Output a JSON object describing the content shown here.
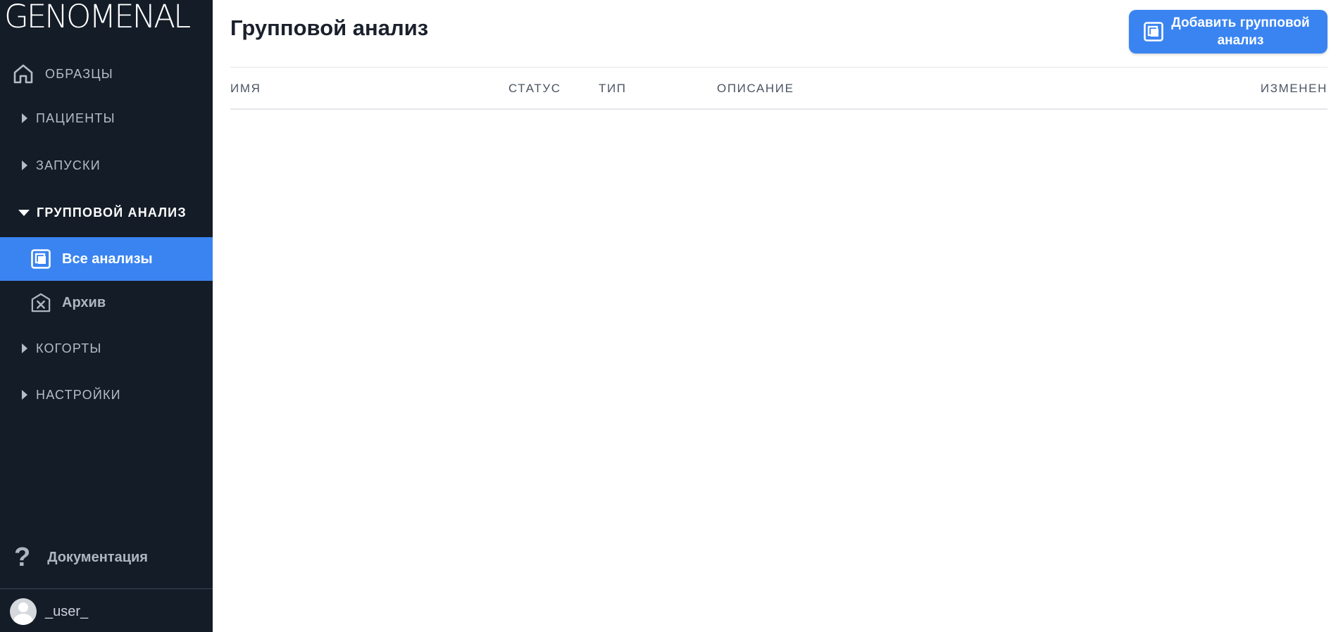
{
  "logo": "GENOMENAL",
  "sidebar": {
    "home_label": "ОБРАЗЦЫ",
    "sections": [
      {
        "label": "ПАЦИЕНТЫ"
      },
      {
        "label": "ЗАПУСКИ"
      },
      {
        "label": "ГРУППОВОЙ АНАЛИЗ"
      },
      {
        "label": "КОГОРТЫ"
      },
      {
        "label": "НАСТРОЙКИ"
      }
    ],
    "sub_items": [
      {
        "label": "Все анализы",
        "icon": "layers-icon"
      },
      {
        "label": "Архив",
        "icon": "archive-x-icon"
      }
    ],
    "documentation_label": "Документация",
    "user_name": "_user_"
  },
  "header": {
    "title": "Групповой анализ",
    "add_button_label": "Добавить групповой анализ"
  },
  "table": {
    "columns": [
      "ИМЯ",
      "СТАТУС",
      "ТИП",
      "ОПИСАНИЕ",
      "ИЗМЕНЕН"
    ],
    "rows": []
  },
  "colors": {
    "sidebar_bg": "#141c27",
    "accent": "#3a84f1"
  }
}
